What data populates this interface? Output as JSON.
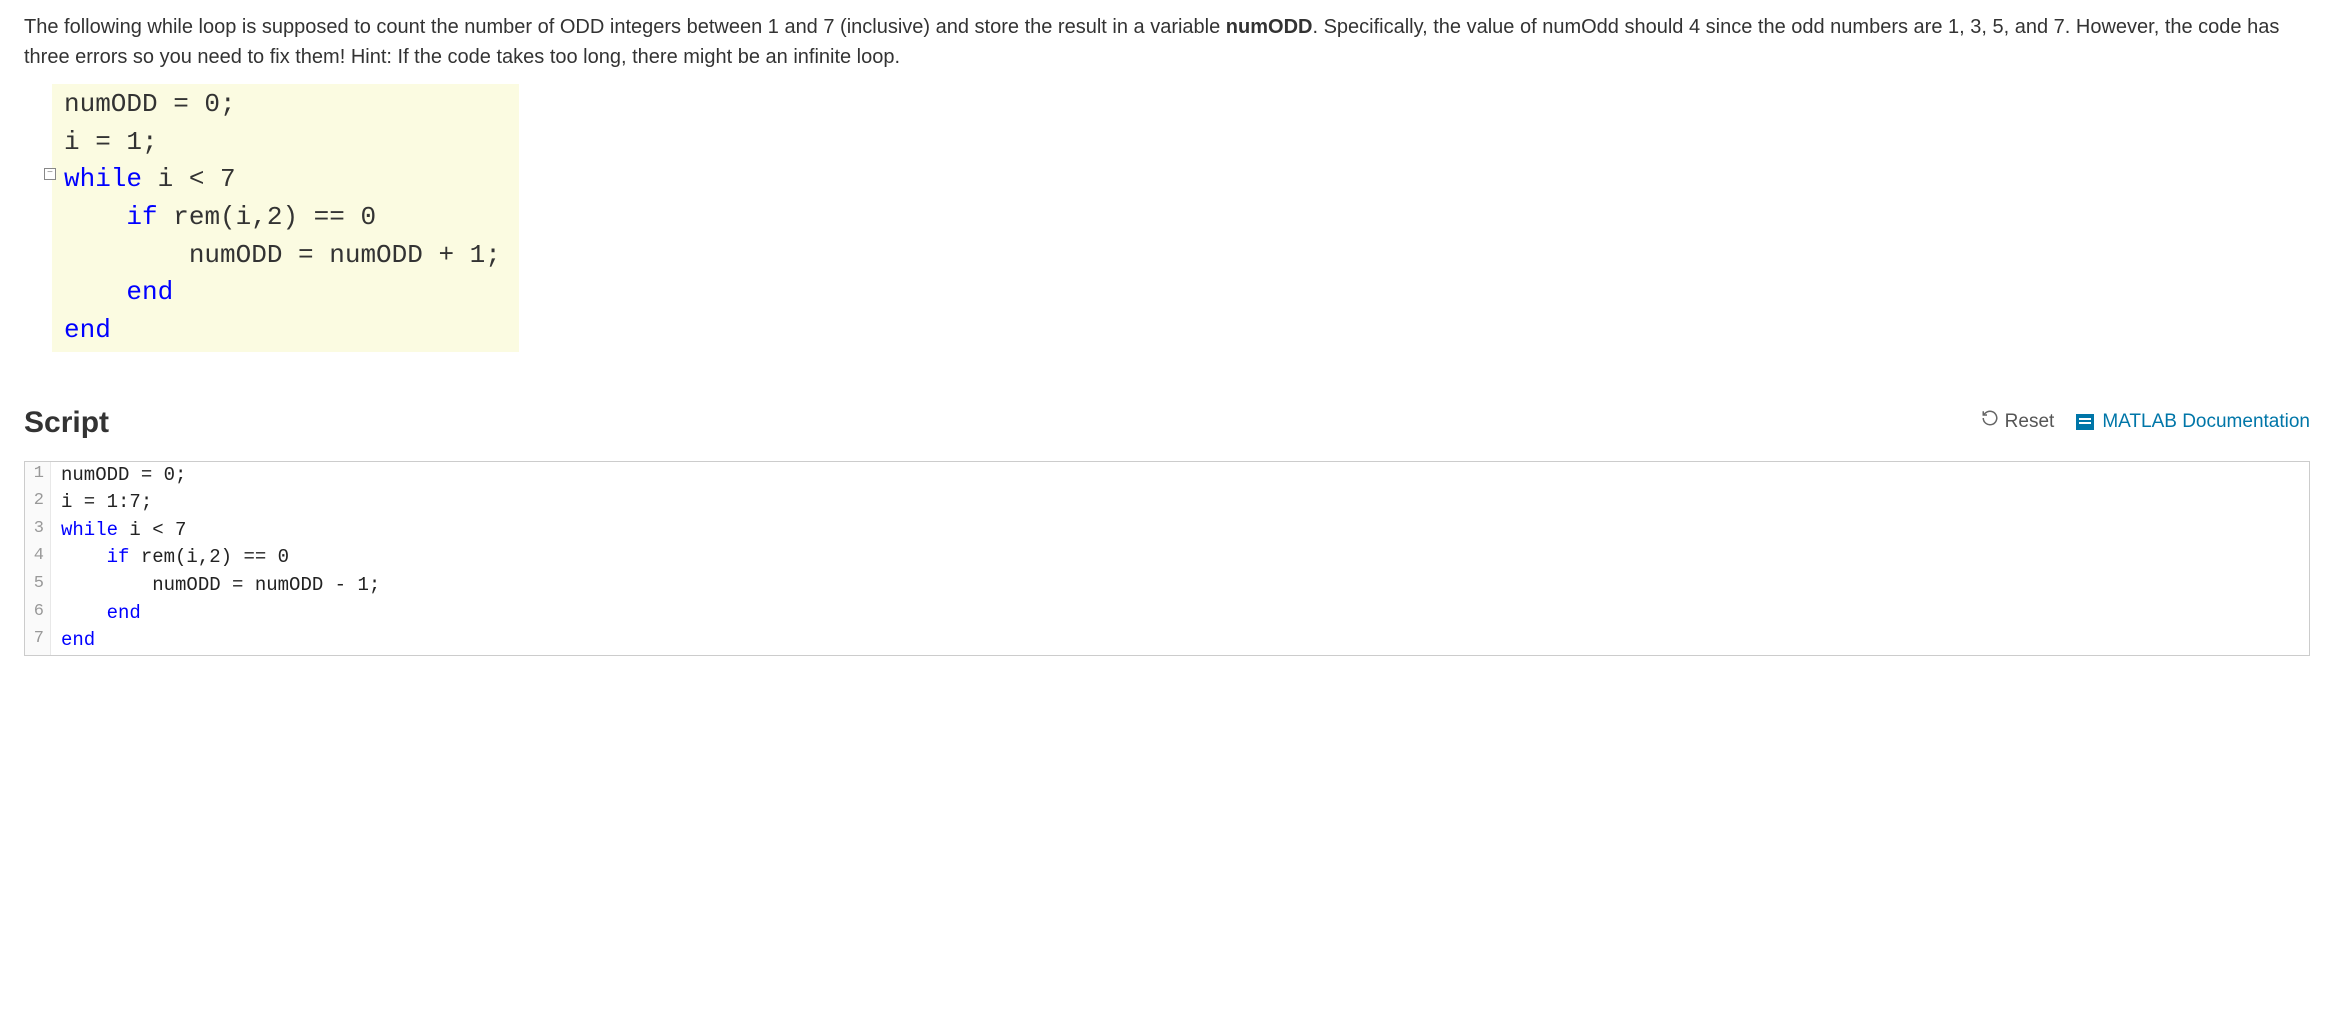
{
  "question": {
    "part1": "The following while loop is supposed to count the number of ODD integers  between 1 and 7 (inclusive) and store the result in a variable ",
    "bold_var": "numODD",
    "part2": ".   Specifically, the value of numOdd should 4 since the odd numbers are 1, 3, 5, and 7. However, the code has three errors so you need to fix them! Hint: If the code takes too long, there might be an infinite loop."
  },
  "example_code": {
    "lines": [
      [
        {
          "t": "numODD = 0;"
        }
      ],
      [
        {
          "t": "i = 1;"
        }
      ],
      [
        {
          "t": "while",
          "c": "k-blue"
        },
        {
          "t": " i < 7"
        }
      ],
      [
        {
          "t": "    "
        },
        {
          "t": "if",
          "c": "k-blue"
        },
        {
          "t": " rem(i,2) == 0"
        }
      ],
      [
        {
          "t": "        numODD = numODD + 1;"
        }
      ],
      [
        {
          "t": "    "
        },
        {
          "t": "end",
          "c": "k-blue"
        }
      ],
      [
        {
          "t": "end",
          "c": "k-blue"
        }
      ]
    ],
    "fold_at_line": 2
  },
  "script": {
    "title": "Script",
    "reset_label": "Reset",
    "doc_label": "MATLAB Documentation"
  },
  "editor_code": {
    "lines": [
      [
        {
          "t": "numODD = 0;"
        }
      ],
      [
        {
          "t": "i = 1:7;"
        }
      ],
      [
        {
          "t": "while",
          "c": "e-kw"
        },
        {
          "t": " i < 7"
        }
      ],
      [
        {
          "t": "    "
        },
        {
          "t": "if",
          "c": "e-kw"
        },
        {
          "t": " rem(i,2) == 0"
        }
      ],
      [
        {
          "t": "        numODD = numODD - 1;"
        }
      ],
      [
        {
          "t": "    "
        },
        {
          "t": "end",
          "c": "e-kw"
        }
      ],
      [
        {
          "t": "end",
          "c": "e-kw"
        }
      ]
    ]
  }
}
